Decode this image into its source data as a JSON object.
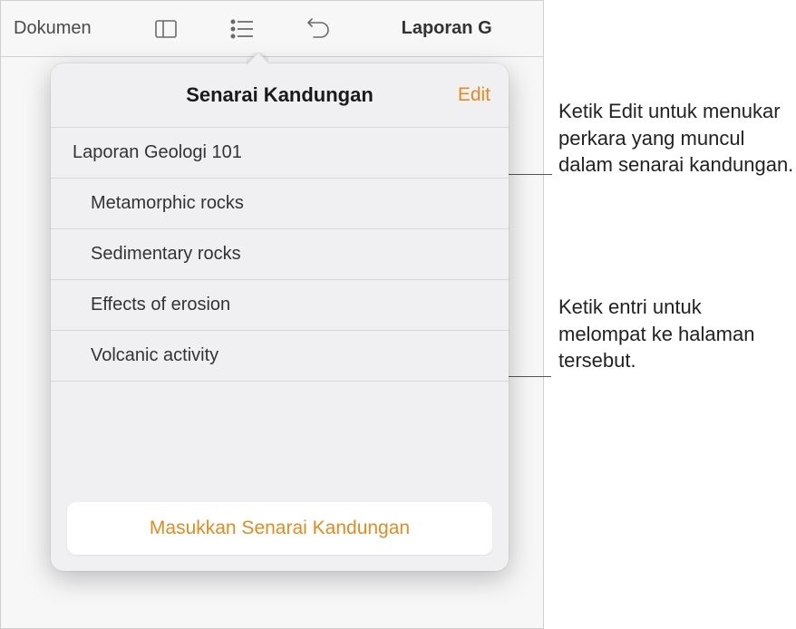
{
  "toolbar": {
    "documents_label": "Dokumen",
    "doc_title": "Laporan G"
  },
  "popover": {
    "title": "Senarai Kandungan",
    "edit_label": "Edit",
    "insert_label": "Masukkan Senarai Kandungan",
    "toc_items": [
      {
        "label": "Laporan Geologi 101",
        "level": 0
      },
      {
        "label": "Metamorphic rocks",
        "level": 1
      },
      {
        "label": "Sedimentary rocks",
        "level": 1
      },
      {
        "label": "Effects of erosion",
        "level": 1
      },
      {
        "label": "Volcanic activity",
        "level": 1
      }
    ]
  },
  "callouts": {
    "c1": "Ketik Edit untuk menukar perkara yang muncul dalam senarai kandungan.",
    "c2": "Ketik entri untuk melompat ke halaman tersebut."
  },
  "colors": {
    "accent": "#e38b1e"
  }
}
